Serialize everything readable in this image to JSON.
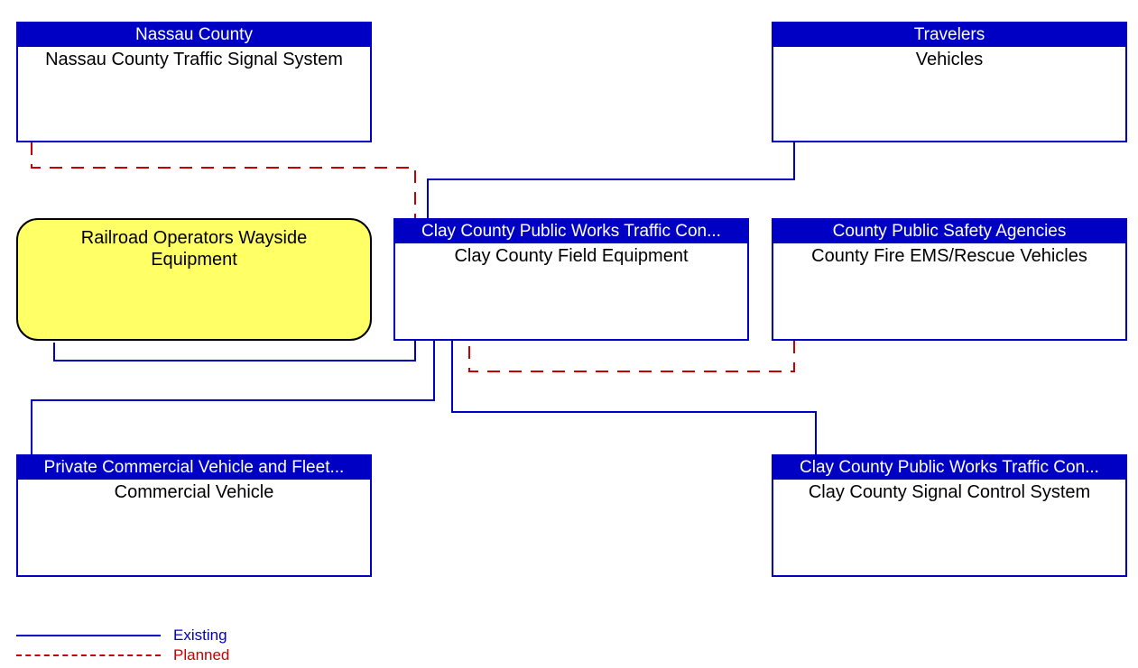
{
  "nodes": {
    "nassau": {
      "header": "Nassau County",
      "body": "Nassau County Traffic Signal System"
    },
    "travelers": {
      "header": "Travelers",
      "body": "Vehicles"
    },
    "railroad": {
      "header": "",
      "body_line1": "Railroad Operators Wayside",
      "body_line2": "Equipment"
    },
    "clay_center": {
      "header": "Clay County Public Works Traffic Con...",
      "body": "Clay County Field Equipment"
    },
    "county_safety": {
      "header": "County Public Safety Agencies",
      "body": "County Fire EMS/Rescue Vehicles"
    },
    "commercial": {
      "header": "Private Commercial Vehicle and Fleet...",
      "body": "Commercial Vehicle"
    },
    "clay_signal": {
      "header": "Clay County Public Works Traffic Con...",
      "body": "Clay County Signal Control System"
    }
  },
  "legend": {
    "existing": "Existing",
    "planned": "Planned"
  },
  "colors": {
    "existing": "#0000c5",
    "planned": "#c40000",
    "node_yellow": "#ffff66",
    "header_bg": "#0000c5",
    "header_fg": "#ffffff"
  }
}
